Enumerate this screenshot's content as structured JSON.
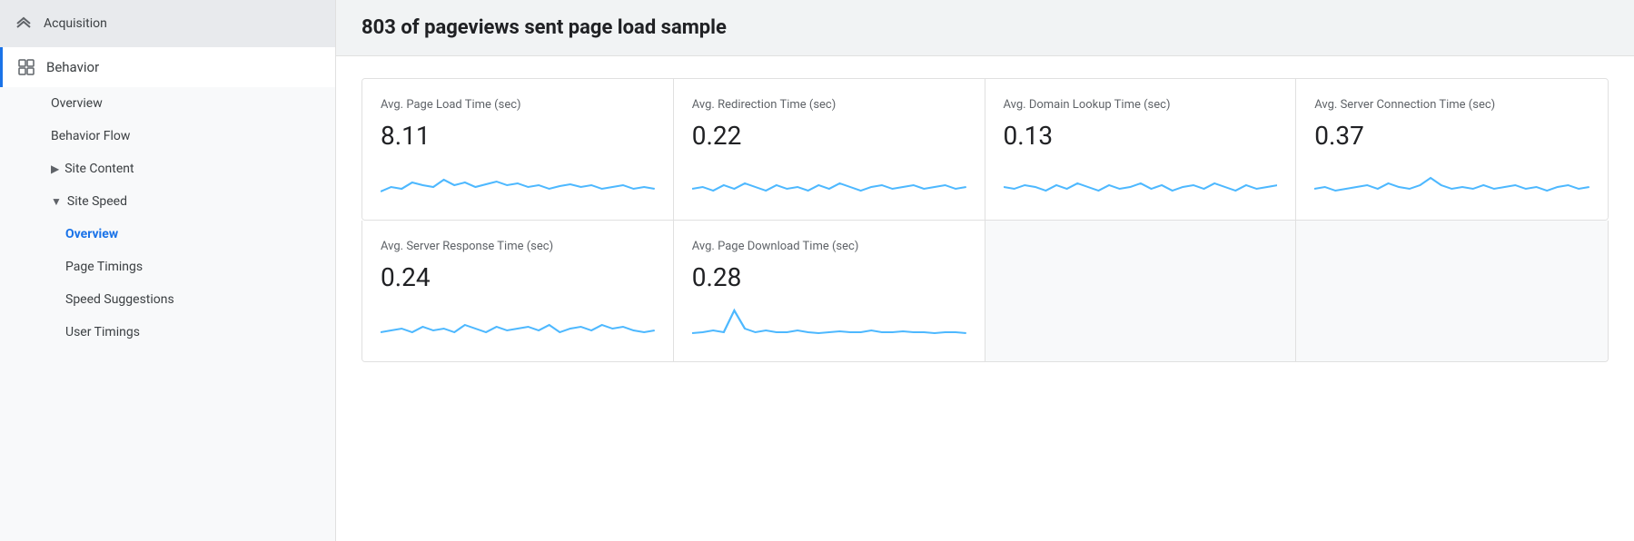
{
  "sidebar": {
    "acquisition": {
      "label": "Acquisition",
      "icon": "→"
    },
    "behavior": {
      "label": "Behavior",
      "icon": "▣"
    },
    "sub_items": [
      {
        "label": "Overview",
        "level": 1,
        "active": false,
        "has_arrow": false
      },
      {
        "label": "Behavior Flow",
        "level": 1,
        "active": false,
        "has_arrow": false
      },
      {
        "label": "Site Content",
        "level": 1,
        "active": false,
        "has_arrow": true,
        "arrow": "▶"
      },
      {
        "label": "Site Speed",
        "level": 1,
        "active": false,
        "has_arrow": true,
        "arrow": "▼",
        "expanded": true
      },
      {
        "label": "Overview",
        "level": 2,
        "active": true
      },
      {
        "label": "Page Timings",
        "level": 2,
        "active": false
      },
      {
        "label": "Speed Suggestions",
        "level": 2,
        "active": false
      },
      {
        "label": "User Timings",
        "level": 2,
        "active": false
      }
    ]
  },
  "header": {
    "title": "803 of pageviews sent page load sample"
  },
  "metrics": [
    {
      "label": "Avg. Page Load Time (sec)",
      "value": "8.11",
      "sparkline_type": "wavy_low"
    },
    {
      "label": "Avg. Redirection Time (sec)",
      "value": "0.22",
      "sparkline_type": "wavy_flat"
    },
    {
      "label": "Avg. Domain Lookup Time (sec)",
      "value": "0.13",
      "sparkline_type": "wavy_flat2"
    },
    {
      "label": "Avg. Server Connection Time (sec)",
      "value": "0.37",
      "sparkline_type": "wavy_spike"
    },
    {
      "label": "Avg. Server Response Time (sec)",
      "value": "0.24",
      "sparkline_type": "wavy_bumpy"
    },
    {
      "label": "Avg. Page Download Time (sec)",
      "value": "0.28",
      "sparkline_type": "wavy_spike2"
    },
    {
      "empty": true
    },
    {
      "empty": true
    }
  ]
}
